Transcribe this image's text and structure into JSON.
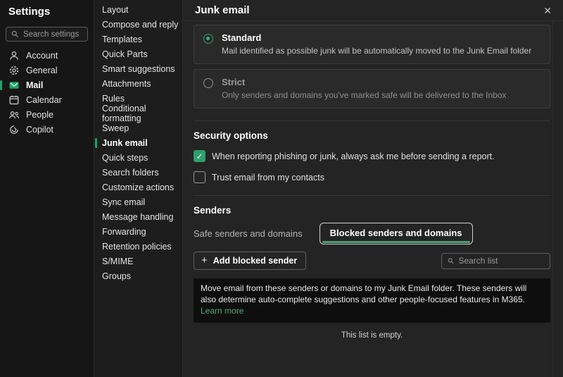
{
  "sidebar": {
    "title": "Settings",
    "search_placeholder": "Search settings",
    "items": [
      {
        "label": "Account"
      },
      {
        "label": "General"
      },
      {
        "label": "Mail"
      },
      {
        "label": "Calendar"
      },
      {
        "label": "People"
      },
      {
        "label": "Copilot"
      }
    ],
    "selected": "Mail"
  },
  "subnav": {
    "items": [
      "Layout",
      "Compose and reply",
      "Templates",
      "Quick Parts",
      "Smart suggestions",
      "Attachments",
      "Rules",
      "Conditional formatting",
      "Sweep",
      "Junk email",
      "Quick steps",
      "Search folders",
      "Customize actions",
      "Sync email",
      "Message handling",
      "Forwarding",
      "Retention policies",
      "S/MIME",
      "Groups"
    ],
    "selected": "Junk email"
  },
  "main": {
    "title": "Junk email",
    "filter_options": [
      {
        "label": "Standard",
        "description": "Mail identified as possible junk will be automatically moved to the Junk Email folder",
        "selected": true
      },
      {
        "label": "Strict",
        "description": "Only senders and domains you've marked safe will be delivered to the Inbox",
        "selected": false
      }
    ],
    "security": {
      "heading": "Security options",
      "checkboxes": [
        {
          "label": "When reporting phishing or junk, always ask me before sending a report.",
          "checked": true
        },
        {
          "label": "Trust email from my contacts",
          "checked": false
        }
      ]
    },
    "senders": {
      "heading": "Senders",
      "tabs": [
        {
          "label": "Safe senders and domains",
          "selected": false
        },
        {
          "label": "Blocked senders and domains",
          "selected": true
        }
      ],
      "add_button_label": "Add blocked sender",
      "search_placeholder": "Search list",
      "banner_text": "Move email from these senders or domains to my Junk Email folder. These senders will also determine auto-complete suggestions and other people-focused features in M365.",
      "banner_link": "Learn more",
      "empty_text": "This list is empty."
    }
  },
  "icons": {
    "close": "✕",
    "plus": "+",
    "check": "✓"
  },
  "colors": {
    "accent_green": "#21a366",
    "checkbox_green": "#2f9e6e",
    "tab_underline_green": "#4e9e77",
    "link_green": "#57a87a",
    "panel_bg": "#242424",
    "sidebar_bg": "#161616",
    "subnav_bg": "#1d1d1d",
    "banner_bg": "#0e0e0e"
  }
}
